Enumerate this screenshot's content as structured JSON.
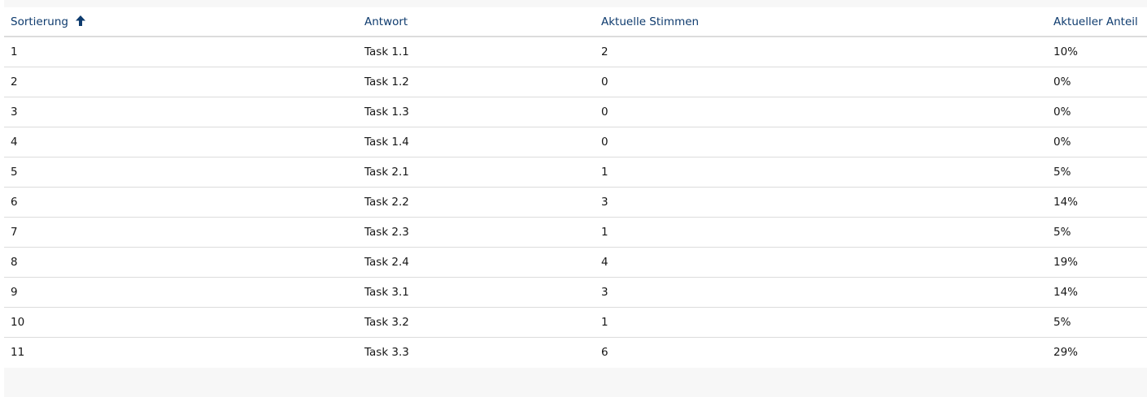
{
  "table": {
    "headers": [
      "Sortierung",
      "Antwort",
      "Aktuelle Stimmen",
      "Aktueller Anteil"
    ],
    "sort_icon": "arrow-up-icon",
    "rows": [
      [
        "1",
        "Task 1.1",
        "2",
        "10%"
      ],
      [
        "2",
        "Task 1.2",
        "0",
        "0%"
      ],
      [
        "3",
        "Task 1.3",
        "0",
        "0%"
      ],
      [
        "4",
        "Task 1.4",
        "0",
        "0%"
      ],
      [
        "5",
        "Task 2.1",
        "1",
        "5%"
      ],
      [
        "6",
        "Task 2.2",
        "3",
        "14%"
      ],
      [
        "7",
        "Task 2.3",
        "1",
        "5%"
      ],
      [
        "8",
        "Task 2.4",
        "4",
        "19%"
      ],
      [
        "9",
        "Task 3.1",
        "3",
        "14%"
      ],
      [
        "10",
        "Task 3.2",
        "1",
        "5%"
      ],
      [
        "11",
        "Task 3.3",
        "6",
        "29%"
      ]
    ]
  },
  "colors": {
    "header_link": "#0e3b6e",
    "row_border": "#dcdcdc",
    "panel_bg": "#f7f7f7"
  }
}
